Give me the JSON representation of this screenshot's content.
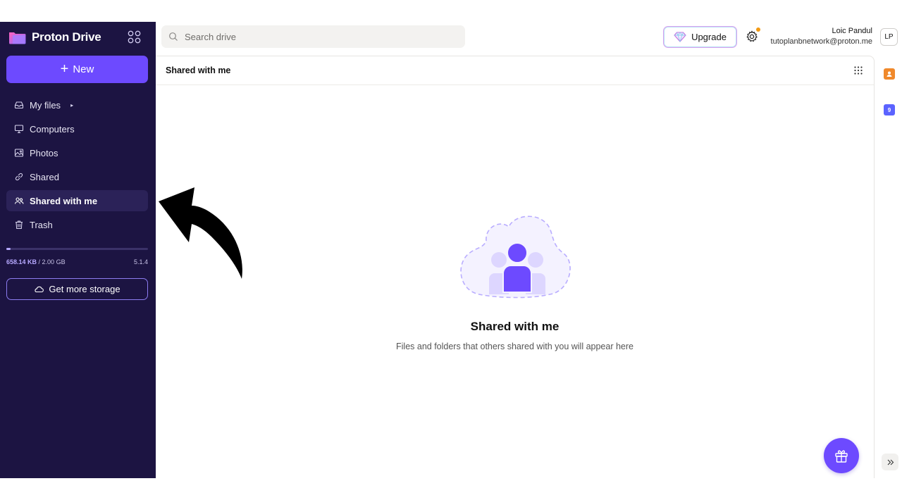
{
  "brand": {
    "name": "Proton Drive",
    "logo_icon": "proton-drive-logo",
    "apps_icon": "apps-grid-icon"
  },
  "sidebar": {
    "new_button": {
      "label": "New",
      "icon": "plus-icon"
    },
    "items": [
      {
        "label": "My files",
        "icon": "cloud-drive-icon",
        "caret": "▸"
      },
      {
        "label": "Computers",
        "icon": "monitor-icon"
      },
      {
        "label": "Photos",
        "icon": "image-icon"
      },
      {
        "label": "Shared",
        "icon": "link-icon"
      },
      {
        "label": "Shared with me",
        "icon": "users-icon",
        "active": true
      },
      {
        "label": "Trash",
        "icon": "trash-icon"
      }
    ],
    "storage": {
      "used": "658.14 KB",
      "separator": " / ",
      "total": "2.00 GB",
      "used_fraction": 0.0003,
      "version": "5.1.4"
    },
    "storage_button": {
      "label": "Get more storage",
      "icon": "cloud-icon"
    }
  },
  "header": {
    "search": {
      "placeholder": "Search drive",
      "icon": "search-icon"
    },
    "upgrade_button": {
      "label": "Upgrade",
      "icon": "diamond-icon"
    },
    "settings_icon": "gear-icon",
    "user": {
      "name": "Loic Pandul",
      "email": "tutoplanbnetwork@proton.me",
      "initials": "LP"
    }
  },
  "main": {
    "title": "Shared with me",
    "empty_state": {
      "title": "Shared with me",
      "subtitle": "Files and folders that others shared with you will appear here"
    }
  },
  "rail": {
    "app2_badge": "9"
  },
  "colors": {
    "sidebar_bg": "#1c1442",
    "accent": "#6d4aff",
    "active_item_bg": "#2b2258"
  }
}
